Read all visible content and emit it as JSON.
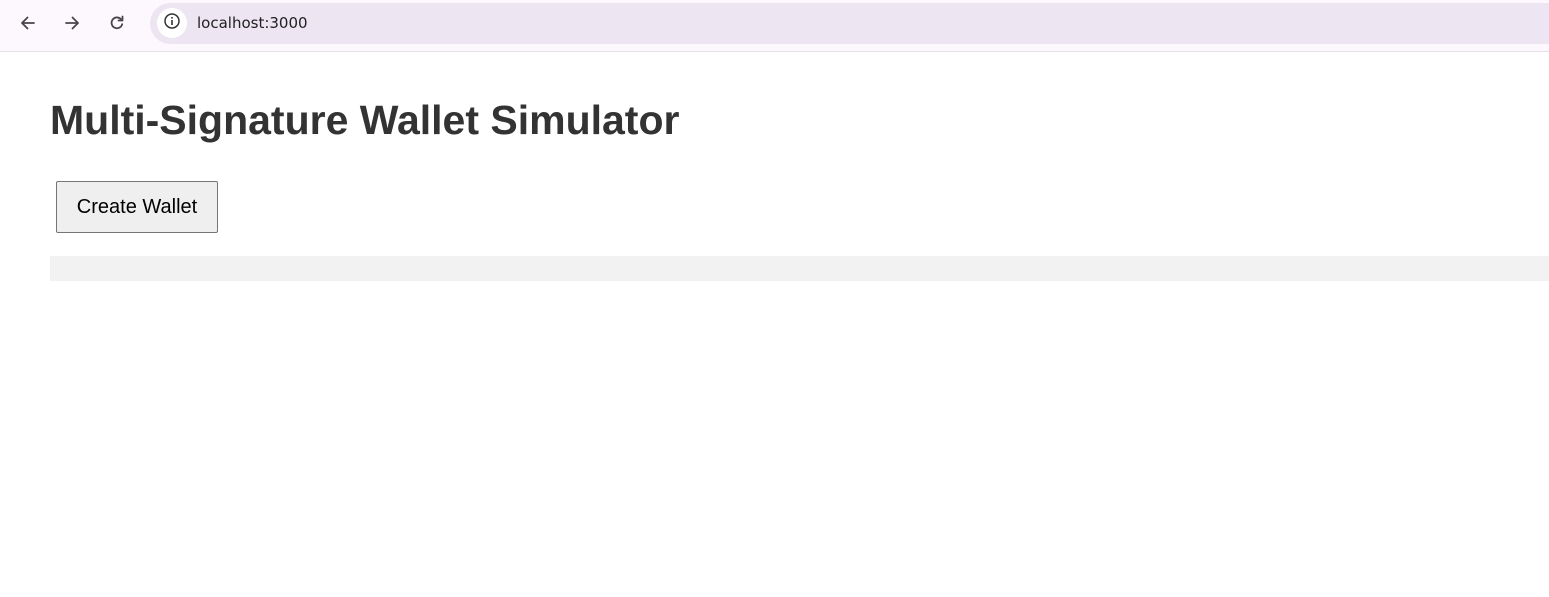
{
  "browser": {
    "url": "localhost:3000",
    "icons": {
      "back": "arrow-left-icon",
      "forward": "arrow-right-icon",
      "reload": "reload-icon",
      "site_info": "info-icon"
    }
  },
  "page": {
    "title": "Multi-Signature Wallet Simulator",
    "create_wallet_label": "Create Wallet",
    "output": ""
  },
  "colors": {
    "title": "#333333",
    "toolbar_bg": "#fdf7fe",
    "address_bar_bg": "#ede5f1",
    "button_bg": "#efefef",
    "output_bg": "#f2f2f2"
  }
}
